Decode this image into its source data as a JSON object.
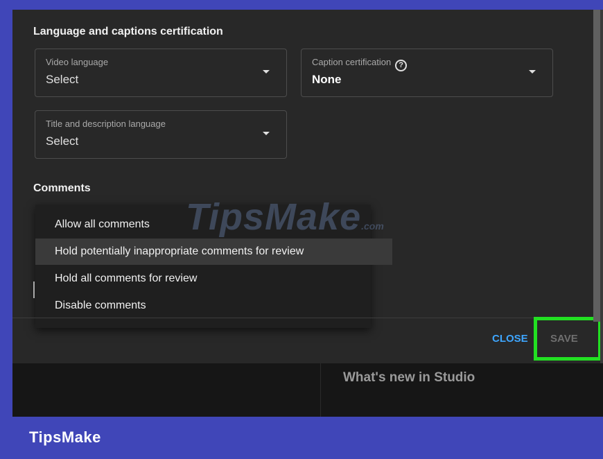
{
  "dialog": {
    "language_section_title": "Language and captions certification",
    "video_language": {
      "label": "Video language",
      "value": "Select"
    },
    "caption_certification": {
      "label": "Caption certification",
      "value": "None",
      "help_icon": "question-circle-icon"
    },
    "title_desc_language": {
      "label": "Title and description language",
      "value": "Select"
    },
    "comments_section_title": "Comments",
    "comments_menu": {
      "options": [
        "Allow all comments",
        "Hold potentially inappropriate comments for review",
        "Hold all comments for review",
        "Disable comments"
      ],
      "highlighted_index": 1
    },
    "footer": {
      "close_label": "CLOSE",
      "save_label": "SAVE"
    }
  },
  "background": {
    "whats_new": "What's new in Studio"
  },
  "watermark": {
    "main": "TipsMake",
    "suffix": ".com"
  },
  "brand": {
    "name": "TipsMake"
  },
  "colors": {
    "frame": "#4046b8",
    "accent_link": "#3ea6ff",
    "highlight_box": "#22e022",
    "dialog_bg": "#282828"
  }
}
